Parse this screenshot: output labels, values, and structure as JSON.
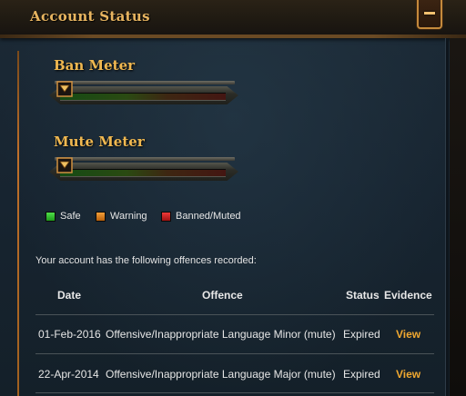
{
  "header": {
    "title": "Account Status",
    "collapse_icon": "minus-icon"
  },
  "ban_meter": {
    "title": "Ban Meter",
    "level": 0
  },
  "mute_meter": {
    "title": "Mute Meter",
    "level": 0
  },
  "legend": [
    {
      "label": "Safe",
      "color": "#2fc32a"
    },
    {
      "label": "Warning",
      "color": "#e0851d"
    },
    {
      "label": "Banned/Muted",
      "color": "#d62222"
    }
  ],
  "offences": {
    "intro": "Your account has the following offences recorded:",
    "columns": {
      "date": "Date",
      "offence": "Offence",
      "status": "Status",
      "evidence": "Evidence"
    },
    "rows": [
      {
        "date": "01-Feb-2016",
        "offence": "Offensive/Inappropriate Language Minor (mute)",
        "status": "Expired",
        "evidence": "View"
      },
      {
        "date": "22-Apr-2014",
        "offence": "Offensive/Inappropriate Language Major (mute)",
        "status": "Expired",
        "evidence": "View"
      }
    ]
  }
}
